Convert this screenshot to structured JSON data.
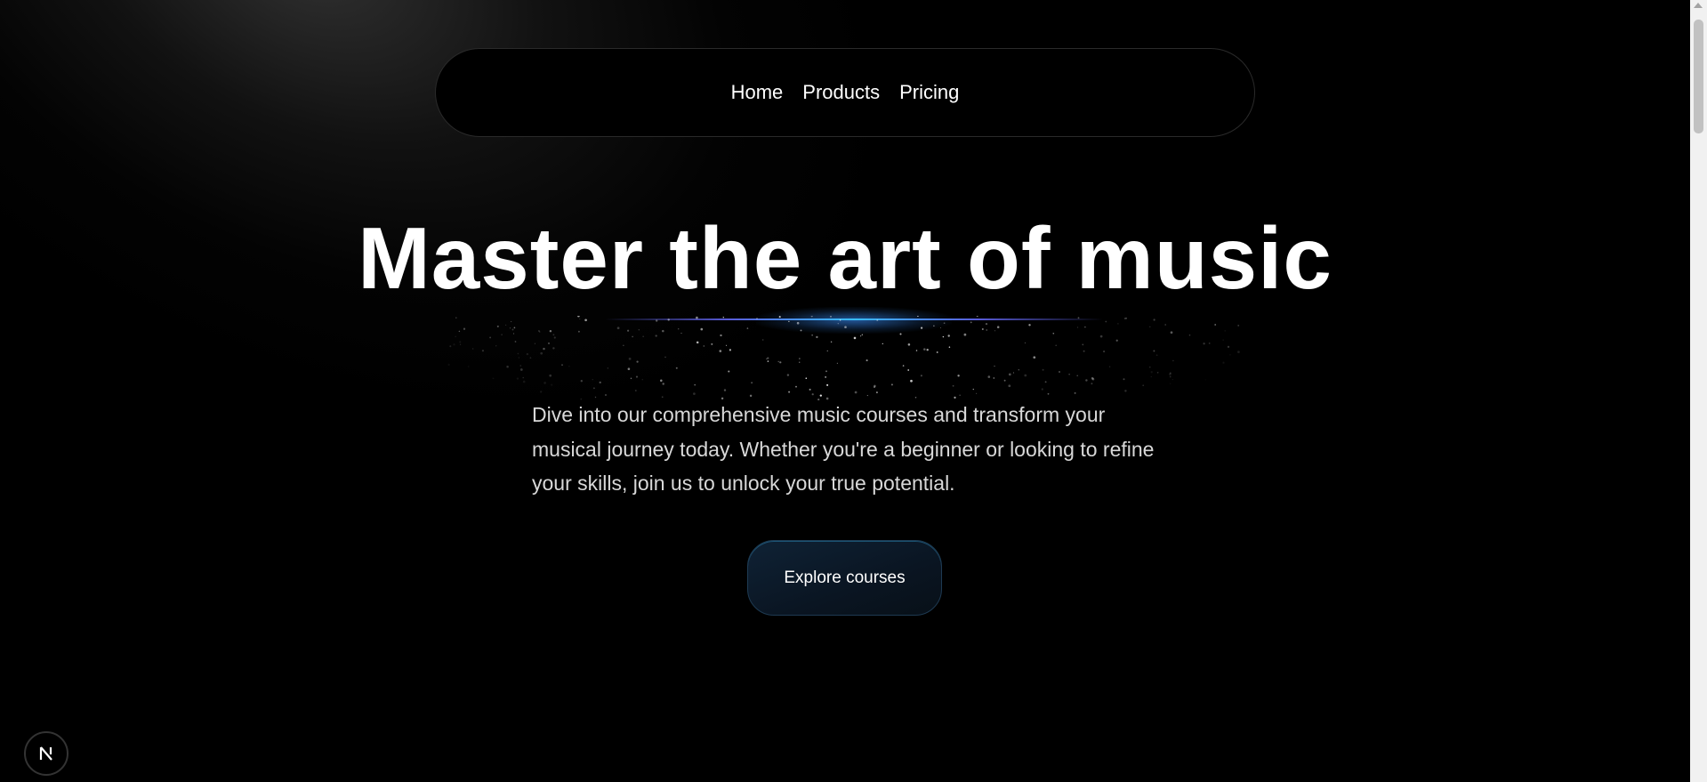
{
  "nav": {
    "items": [
      {
        "label": "Home"
      },
      {
        "label": "Products"
      },
      {
        "label": "Pricing"
      }
    ]
  },
  "hero": {
    "title": "Master the art of music",
    "description": "Dive into our comprehensive music courses and transform your musical journey today. Whether you're a beginner or looking to refine your skills, join us to unlock your true potential.",
    "cta_label": "Explore courses"
  },
  "badge": {
    "letter": "N"
  },
  "colors": {
    "background": "#000000",
    "accent_blue": "#38bdf8",
    "accent_indigo": "#6366f1",
    "button_bg": "#0f2235"
  }
}
